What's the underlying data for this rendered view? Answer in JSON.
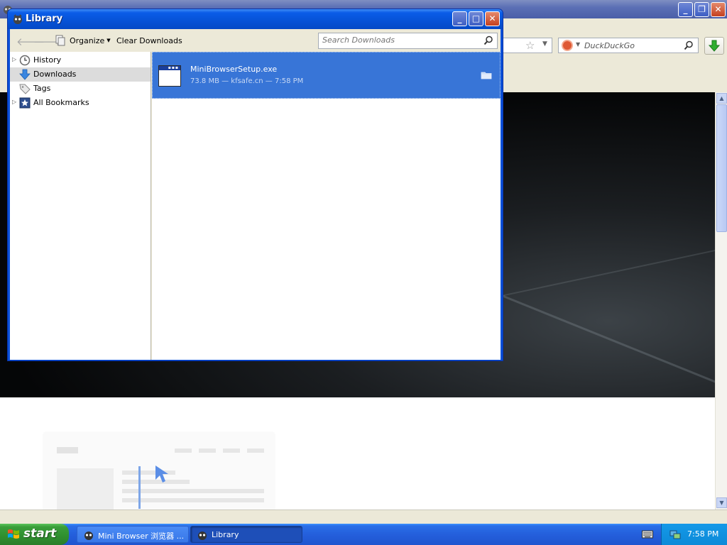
{
  "library": {
    "title": "Library",
    "toolbar": {
      "organize_label": "Organize",
      "clear_downloads_label": "Clear Downloads",
      "search_placeholder": "Search Downloads"
    },
    "sidebar": {
      "items": [
        {
          "label": "History",
          "icon": "history-clock-icon",
          "expandable": true
        },
        {
          "label": "Downloads",
          "icon": "download-arrow-icon",
          "selected": true
        },
        {
          "label": "Tags",
          "icon": "tag-icon"
        },
        {
          "label": "All Bookmarks",
          "icon": "bookmark-star-icon",
          "expandable": true
        }
      ]
    },
    "downloads": [
      {
        "filename": "MiniBrowserSetup.exe",
        "meta": "73.8 MB — kfsafe.cn — 7:58 PM"
      }
    ]
  },
  "browser": {
    "search_engine": "DuckDuckGo"
  },
  "taskbar": {
    "start_label": "start",
    "tasks": [
      {
        "label": "Mini Browser 浏览器 ...",
        "active": false
      },
      {
        "label": "Library",
        "active": true
      }
    ],
    "clock": "7:58 PM"
  },
  "colors": {
    "xp_blue_title": "#0a5ce8",
    "selection_blue": "#3875d7",
    "start_green": "#3a9e3a",
    "taskbar_blue": "#245fdc"
  }
}
